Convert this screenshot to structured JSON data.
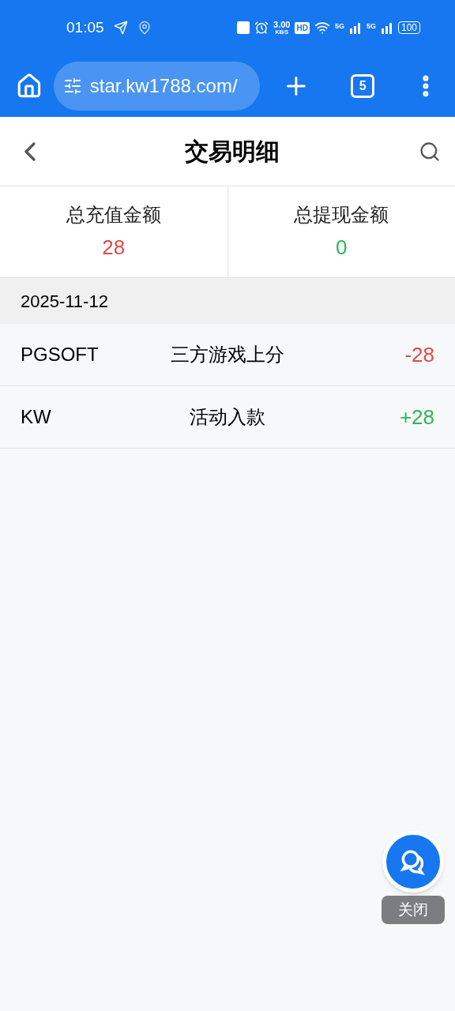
{
  "status_bar": {
    "time": "01:05",
    "speed": "3.00",
    "speed_unit": "KB/S",
    "hd": "HD",
    "sim1": "5G",
    "sim2": "5G",
    "battery": "100"
  },
  "browser": {
    "url": "star.kw1788.com/",
    "tab_count": "5"
  },
  "header": {
    "title": "交易明细"
  },
  "summary": [
    {
      "label": "总充值金额",
      "value": "28",
      "color": "#e04a4a"
    },
    {
      "label": "总提现金额",
      "value": "0",
      "color": "#2fb45a"
    }
  ],
  "date": "2025-11-12",
  "rows": [
    {
      "source": "PGSOFT",
      "type": "三方游戏上分",
      "amount": "-28",
      "color": "#e04a4a"
    },
    {
      "source": "KW",
      "type": "活动入款",
      "amount": "+28",
      "color": "#2fb45a"
    }
  ],
  "float": {
    "close": "关闭"
  }
}
